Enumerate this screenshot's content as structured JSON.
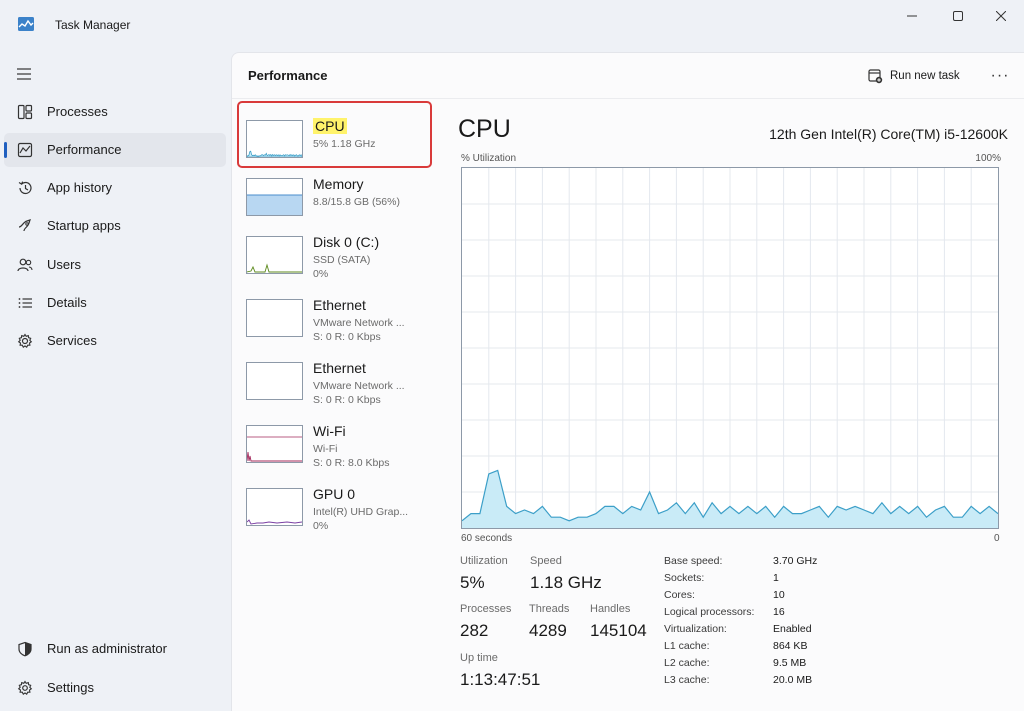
{
  "window": {
    "title": "Task Manager"
  },
  "sidebar": {
    "items": [
      {
        "label": "Processes",
        "icon": "processes-icon"
      },
      {
        "label": "Performance",
        "icon": "performance-icon",
        "active": true
      },
      {
        "label": "App history",
        "icon": "app-history-icon"
      },
      {
        "label": "Startup apps",
        "icon": "startup-apps-icon"
      },
      {
        "label": "Users",
        "icon": "users-icon"
      },
      {
        "label": "Details",
        "icon": "details-icon"
      },
      {
        "label": "Services",
        "icon": "services-icon"
      }
    ],
    "bottom": [
      {
        "label": "Run as administrator",
        "icon": "shield-icon"
      },
      {
        "label": "Settings",
        "icon": "gear-icon"
      }
    ]
  },
  "header": {
    "title": "Performance",
    "run_task_label": "Run new task",
    "more_label": "···"
  },
  "devices": [
    {
      "name": "CPU",
      "line1": "5% 1.18 GHz",
      "line2": "",
      "selected": true
    },
    {
      "name": "Memory",
      "line1": "8.8/15.8 GB (56%)",
      "line2": ""
    },
    {
      "name": "Disk 0 (C:)",
      "line1": "SSD (SATA)",
      "line2": "0%"
    },
    {
      "name": "Ethernet",
      "line1": "VMware Network ...",
      "line2": "S: 0 R: 0 Kbps"
    },
    {
      "name": "Ethernet",
      "line1": "VMware Network ...",
      "line2": "S: 0 R: 0 Kbps"
    },
    {
      "name": "Wi-Fi",
      "line1": "Wi-Fi",
      "line2": "S: 0 R: 8.0 Kbps"
    },
    {
      "name": "GPU 0",
      "line1": "Intel(R) UHD Grap...",
      "line2": "0%"
    }
  ],
  "detail": {
    "title": "CPU",
    "model": "12th Gen Intel(R) Core(TM) i5-12600K",
    "y_label": "% Utilization",
    "y_max_label": "100%",
    "x_left_label": "60 seconds",
    "x_right_label": "0",
    "stats": {
      "utilization_label": "Utilization",
      "utilization": "5%",
      "speed_label": "Speed",
      "speed": "1.18 GHz",
      "processes_label": "Processes",
      "processes": "282",
      "threads_label": "Threads",
      "threads": "4289",
      "handles_label": "Handles",
      "handles": "145104",
      "uptime_label": "Up time",
      "uptime": "1:13:47:51"
    },
    "specs": [
      {
        "label": "Base speed:",
        "value": "3.70 GHz"
      },
      {
        "label": "Sockets:",
        "value": "1"
      },
      {
        "label": "Cores:",
        "value": "10"
      },
      {
        "label": "Logical processors:",
        "value": "16"
      },
      {
        "label": "Virtualization:",
        "value": "Enabled"
      },
      {
        "label": "L1 cache:",
        "value": "864 KB"
      },
      {
        "label": "L2 cache:",
        "value": "9.5 MB"
      },
      {
        "label": "L3 cache:",
        "value": "20.0 MB"
      }
    ]
  },
  "colors": {
    "accent": "#1f5fbf",
    "cpu_line": "#3c9fc8",
    "cpu_fill": "#c9ebf7",
    "memory_fill": "#b8d7f2",
    "disk_line": "#5c8a1c",
    "wifi_line": "#a3275a",
    "gpu_line": "#7a3fa3",
    "highlight": "#d93a3a"
  },
  "chart_data": {
    "type": "area",
    "x": [
      0,
      1,
      2,
      3,
      4,
      5,
      6,
      7,
      8,
      9,
      10,
      11,
      12,
      13,
      14,
      15,
      16,
      17,
      18,
      19,
      20,
      21,
      22,
      23,
      24,
      25,
      26,
      27,
      28,
      29,
      30,
      31,
      32,
      33,
      34,
      35,
      36,
      37,
      38,
      39,
      40,
      41,
      42,
      43,
      44,
      45,
      46,
      47,
      48,
      49,
      50,
      51,
      52,
      53,
      54,
      55,
      56,
      57,
      58,
      59,
      60
    ],
    "values": [
      2,
      4,
      4,
      15,
      16,
      6,
      4,
      5,
      4,
      6,
      3,
      3,
      2,
      3,
      3,
      4,
      6,
      6,
      4,
      6,
      5,
      10,
      4,
      5,
      7,
      4,
      7,
      3,
      7,
      4,
      6,
      4,
      6,
      4,
      6,
      3,
      6,
      4,
      4,
      5,
      6,
      3,
      6,
      5,
      6,
      5,
      4,
      7,
      4,
      6,
      4,
      6,
      3,
      5,
      6,
      3,
      3,
      6,
      4,
      6,
      4
    ],
    "ylim": [
      0,
      100
    ],
    "xlim": [
      0,
      60
    ],
    "grid": true
  }
}
